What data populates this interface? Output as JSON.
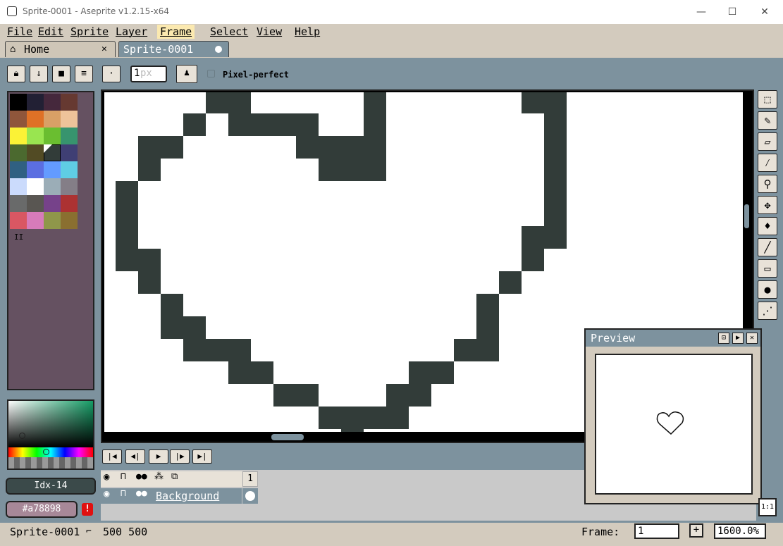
{
  "window": {
    "title": "Sprite-0001 - Aseprite v1.2.15-x64",
    "minimize": "—",
    "maximize": "☐",
    "close": "✕"
  },
  "menu": [
    "File",
    "Edit",
    "Sprite",
    "Layer",
    "Frame",
    "Select",
    "View",
    "Help"
  ],
  "tabs": {
    "home": {
      "label": "Home",
      "close": "✕"
    },
    "sprite": {
      "label": "Sprite-0001"
    }
  },
  "contextbar": {
    "brush_size_placeholder": "1px",
    "brush_size_value": "1",
    "pixel_perfect_label": "Pixel-perfect"
  },
  "palette": {
    "colors": [
      "#000000",
      "#222034",
      "#45283c",
      "#663931",
      "#8f563b",
      "#df7126",
      "#d9a066",
      "#eec39a",
      "#fbf236",
      "#99e550",
      "#6abe30",
      "#37946e",
      "#4b692f",
      "#524b24",
      "#323c39",
      "#3f3f74",
      "#306082",
      "#5b6ee1",
      "#639bff",
      "#5fcde4",
      "#cbdbfc",
      "#ffffff",
      "#9badb7",
      "#847e87",
      "#696a6a",
      "#595652",
      "#76428a",
      "#ac3232",
      "#d95763",
      "#d77bba",
      "#8f974a",
      "#8a6f30"
    ],
    "selected_index": 14,
    "handle": "II"
  },
  "color_indicators": {
    "index_label": "Idx-14",
    "hex_label": "#a78898",
    "warning": "!"
  },
  "tools": [
    "rect-select",
    "pencil",
    "eraser",
    "eyedropper",
    "zoom",
    "move",
    "paint-bucket",
    "line",
    "rectangle",
    "blur",
    "spray"
  ],
  "preview": {
    "title": "Preview"
  },
  "timeline": {
    "frame_number": "1",
    "layer_name": "Background"
  },
  "statusbar": {
    "sprite_name": "Sprite-0001",
    "size": "500 500",
    "frame_label": "Frame:",
    "frame_value": "1",
    "add_frame": "+",
    "zoom": "1600.0%",
    "one_to_one": "1:1"
  },
  "colors": {
    "ink": "#323c39",
    "panel": "#d3cbbe",
    "workspace": "#7d929e",
    "palette_bg": "#655161",
    "highlight": "#fbe9b0"
  }
}
